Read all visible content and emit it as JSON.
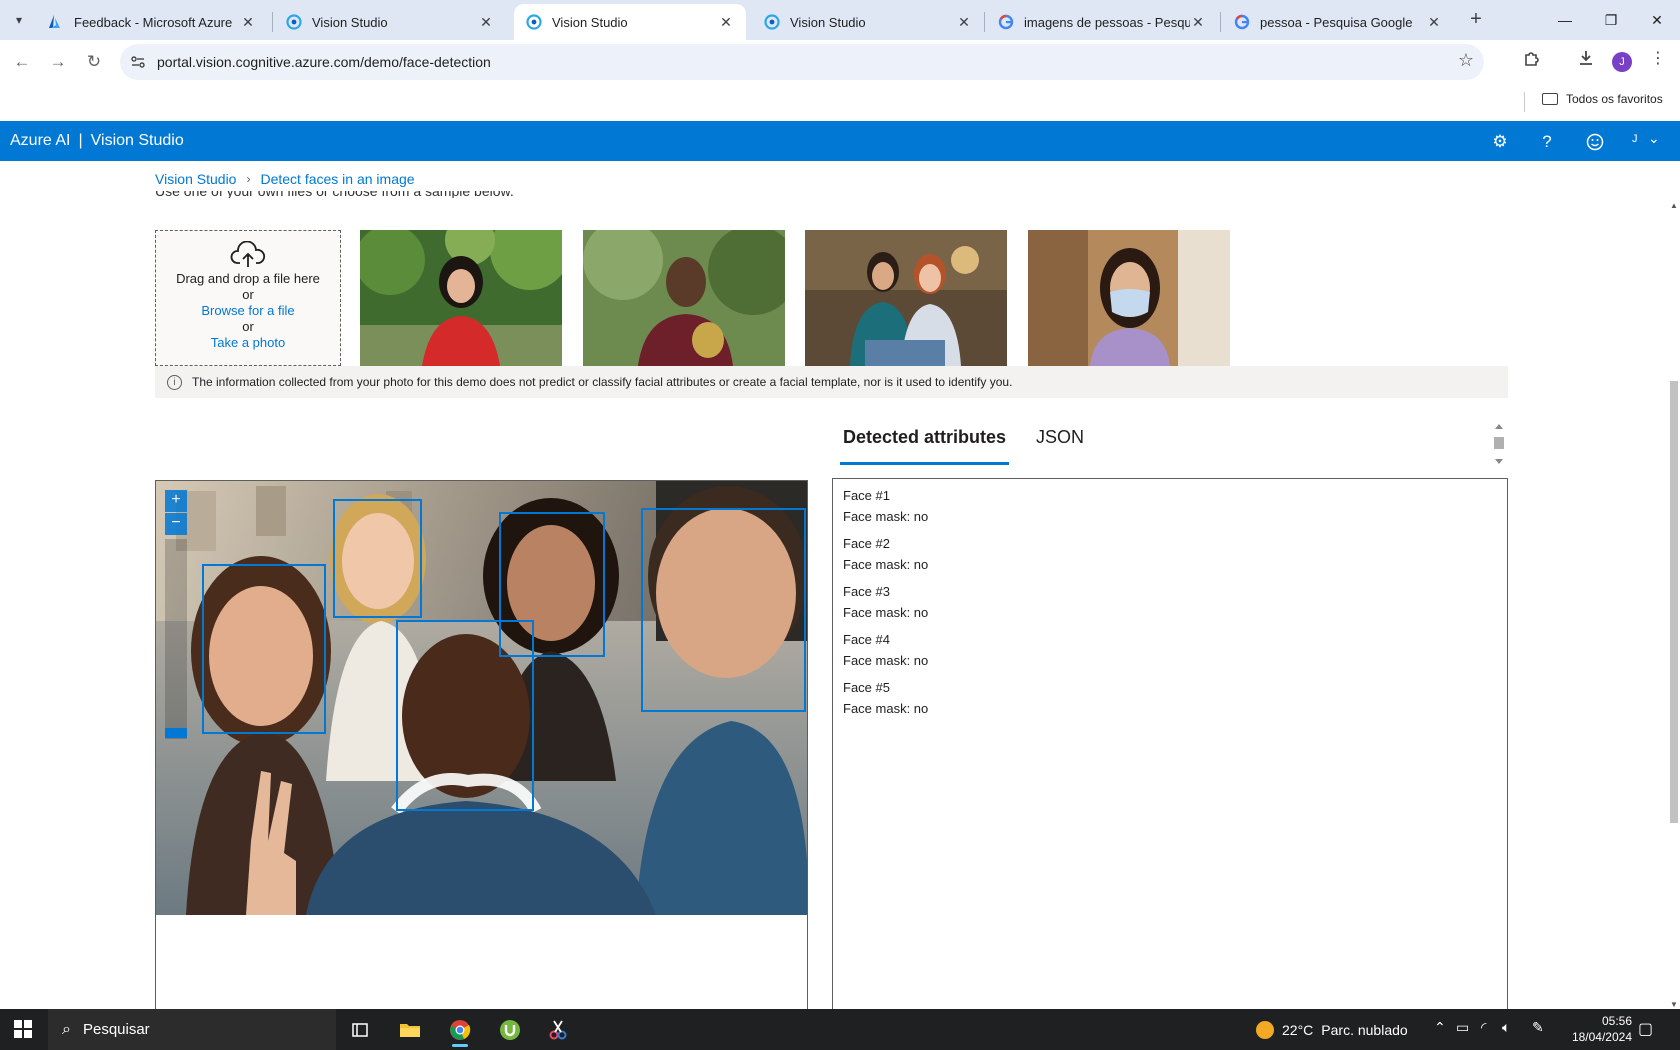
{
  "browser": {
    "tabs": [
      {
        "title": "Feedback - Microsoft Azure",
        "icon": "azure-logo-icon",
        "active": false
      },
      {
        "title": "Vision Studio",
        "icon": "vision-studio-icon",
        "active": false
      },
      {
        "title": "Vision Studio",
        "icon": "vision-studio-icon",
        "active": true
      },
      {
        "title": "Vision Studio",
        "icon": "vision-studio-icon",
        "active": false
      },
      {
        "title": "imagens de pessoas - Pesquisa",
        "icon": "google-icon",
        "active": false
      },
      {
        "title": "pessoa - Pesquisa Google",
        "icon": "google-icon",
        "active": false
      }
    ],
    "url": "portal.vision.cognitive.azure.com/demo/face-detection",
    "profile_initial": "J",
    "bookmarks": {
      "all_bookmarks_label": "Todos os favoritos"
    }
  },
  "azure_header": {
    "brand": "Azure AI",
    "separator": "|",
    "product": "Vision Studio",
    "user_initial": "J",
    "color": "#0078d4"
  },
  "breadcrumb": {
    "items": [
      "Vision Studio",
      "Detect faces in an image"
    ]
  },
  "intro_text_cut": "Use one of your own files or choose from a sample below.",
  "upload": {
    "drag_text": "Drag and drop a file here",
    "or_1": "or",
    "browse_link": "Browse for a file",
    "or_2": "or",
    "photo_link": "Take a photo"
  },
  "samples": [
    {
      "icon": "sample-woman-red-dress"
    },
    {
      "icon": "sample-man-maroon-shirt"
    },
    {
      "icon": "sample-two-women-office"
    },
    {
      "icon": "sample-woman-face-mask"
    }
  ],
  "notice": "The information collected from your photo for this demo does not predict or classify facial attributes or create a facial template, nor is it used to identify you.",
  "results_tabs": {
    "detected_attributes": "Detected attributes",
    "json": "JSON",
    "active": "detected_attributes"
  },
  "zoom": {
    "in": "+",
    "out": "−"
  },
  "faces": [
    {
      "name": "Face #1",
      "mask": "Face mask: no"
    },
    {
      "name": "Face #2",
      "mask": "Face mask: no"
    },
    {
      "name": "Face #3",
      "mask": "Face mask: no"
    },
    {
      "name": "Face #4",
      "mask": "Face mask: no"
    },
    {
      "name": "Face #5",
      "mask": "Face mask: no"
    }
  ],
  "taskbar": {
    "search_placeholder": "Pesquisar",
    "weather": {
      "temp": "22°C",
      "desc": "Parc. nublado"
    },
    "time": "05:56",
    "date": "18/04/2024"
  }
}
